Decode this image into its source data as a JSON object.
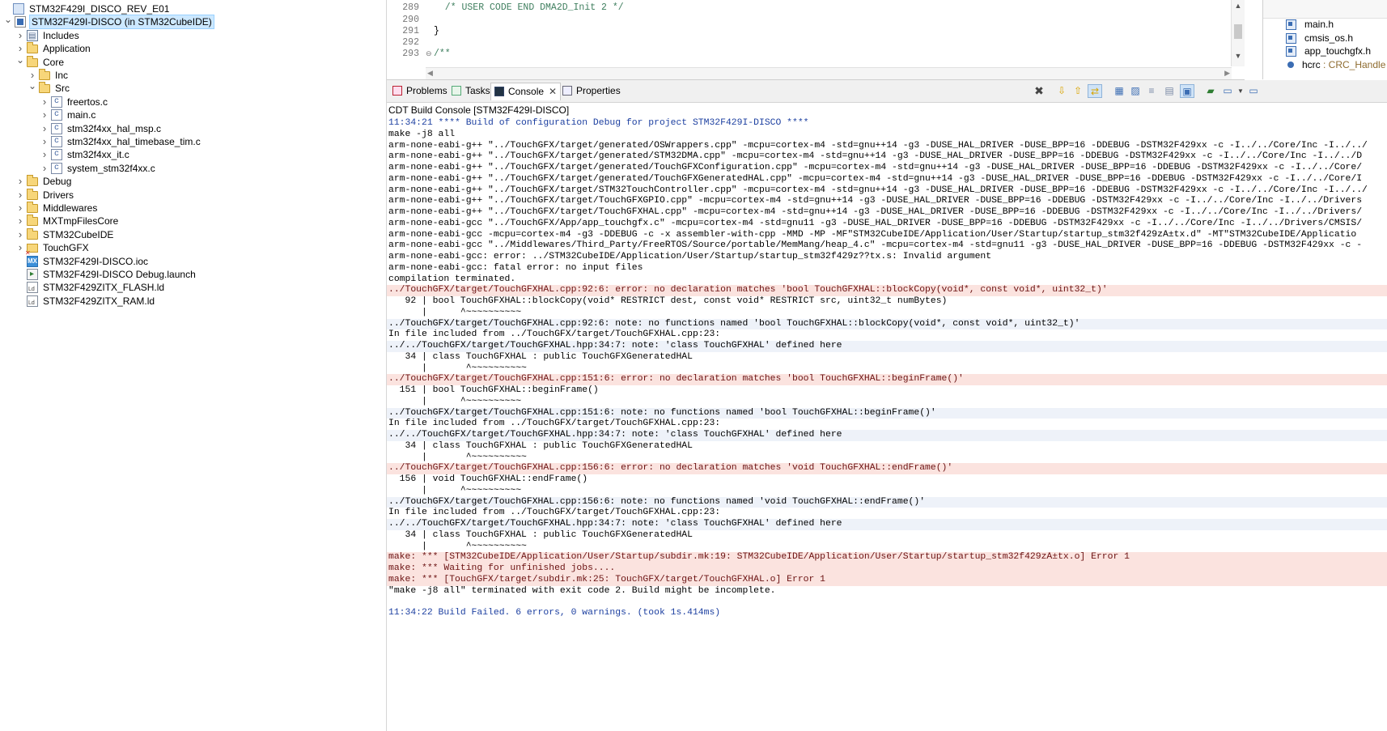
{
  "explorer": {
    "items": [
      {
        "label": "STM32F429I_DISCO_REV_E01",
        "icon": "project-icon",
        "twisty": ""
      },
      {
        "label": "STM32F429I-DISCO (in STM32CubeIDE)",
        "icon": "ide-project-icon",
        "twisty": "expanded"
      },
      {
        "label": "Includes",
        "icon": "includes-icon",
        "twisty": "collapsed"
      },
      {
        "label": "Application",
        "icon": "folder-icon",
        "twisty": "collapsed"
      },
      {
        "label": "Core",
        "icon": "folder-icon",
        "twisty": "expanded"
      },
      {
        "label": "Inc",
        "icon": "folder-icon",
        "twisty": "collapsed"
      },
      {
        "label": "Src",
        "icon": "folder-icon",
        "twisty": "expanded"
      },
      {
        "label": "freertos.c",
        "icon": "c-file-icon",
        "twisty": "collapsed"
      },
      {
        "label": "main.c",
        "icon": "c-file-icon",
        "twisty": "collapsed"
      },
      {
        "label": "stm32f4xx_hal_msp.c",
        "icon": "c-file-icon",
        "twisty": "collapsed"
      },
      {
        "label": "stm32f4xx_hal_timebase_tim.c",
        "icon": "c-file-icon",
        "twisty": "collapsed"
      },
      {
        "label": "stm32f4xx_it.c",
        "icon": "c-file-icon",
        "twisty": "collapsed"
      },
      {
        "label": "system_stm32f4xx.c",
        "icon": "c-file-icon",
        "twisty": "collapsed"
      },
      {
        "label": "Debug",
        "icon": "folder-icon",
        "twisty": "collapsed"
      },
      {
        "label": "Drivers",
        "icon": "folder-icon",
        "twisty": "collapsed"
      },
      {
        "label": "Middlewares",
        "icon": "folder-icon",
        "twisty": "collapsed"
      },
      {
        "label": "MXTmpFilesCore",
        "icon": "folder-icon",
        "twisty": "collapsed"
      },
      {
        "label": "STM32CubeIDE",
        "icon": "folder-icon",
        "twisty": "collapsed"
      },
      {
        "label": "TouchGFX",
        "icon": "folder-error-icon",
        "twisty": "collapsed"
      },
      {
        "label": "STM32F429I-DISCO.ioc",
        "icon": "mx-file-icon",
        "twisty": ""
      },
      {
        "label": "STM32F429I-DISCO Debug.launch",
        "icon": "launch-file-icon",
        "twisty": ""
      },
      {
        "label": "STM32F429ZITX_FLASH.ld",
        "icon": "ld-file-icon",
        "twisty": ""
      },
      {
        "label": "STM32F429ZITX_RAM.ld",
        "icon": "ld-file-icon",
        "twisty": ""
      }
    ]
  },
  "editor": {
    "lines": [
      {
        "num": "289",
        "code": "  /* USER CODE END DMA2D_Init 2 */",
        "kind": "comment"
      },
      {
        "num": "290",
        "code": "",
        "kind": "code"
      },
      {
        "num": "291",
        "code": "}",
        "kind": "code"
      },
      {
        "num": "292",
        "code": "",
        "kind": "code"
      },
      {
        "num": "293",
        "code": "/**",
        "kind": "comment"
      }
    ]
  },
  "outline": {
    "items": [
      {
        "label": "main.h",
        "type": "",
        "icon": "header-file-icon"
      },
      {
        "label": "cmsis_os.h",
        "type": "",
        "icon": "header-file-icon"
      },
      {
        "label": "app_touchgfx.h",
        "type": "",
        "icon": "header-file-icon"
      },
      {
        "label": "hcrc",
        "type": " : CRC_Handle",
        "icon": "variable-icon"
      }
    ]
  },
  "console": {
    "tabs": [
      {
        "label": "Problems",
        "icon": "problems-icon"
      },
      {
        "label": "Tasks",
        "icon": "tasks-icon"
      },
      {
        "label": "Console",
        "icon": "console-icon"
      },
      {
        "label": "Properties",
        "icon": "properties-icon"
      }
    ],
    "close_glyph": "✕",
    "title": "CDT Build Console [STM32F429I-DISCO]",
    "lines": [
      {
        "text": "11:34:21 **** Build of configuration Debug for project STM32F429I-DISCO ****",
        "kind": "info"
      },
      {
        "text": "make -j8 all",
        "kind": "normal"
      },
      {
        "text": "arm-none-eabi-g++ \"../TouchGFX/target/generated/OSWrappers.cpp\" -mcpu=cortex-m4 -std=gnu++14 -g3 -DUSE_HAL_DRIVER -DUSE_BPP=16 -DDEBUG -DSTM32F429xx -c -I../../Core/Inc -I../../",
        "kind": "normal"
      },
      {
        "text": "arm-none-eabi-g++ \"../TouchGFX/target/generated/STM32DMA.cpp\" -mcpu=cortex-m4 -std=gnu++14 -g3 -DUSE_HAL_DRIVER -DUSE_BPP=16 -DDEBUG -DSTM32F429xx -c -I../../Core/Inc -I../../D",
        "kind": "normal"
      },
      {
        "text": "arm-none-eabi-g++ \"../TouchGFX/target/generated/TouchGFXConfiguration.cpp\" -mcpu=cortex-m4 -std=gnu++14 -g3 -DUSE_HAL_DRIVER -DUSE_BPP=16 -DDEBUG -DSTM32F429xx -c -I../../Core/",
        "kind": "normal"
      },
      {
        "text": "arm-none-eabi-g++ \"../TouchGFX/target/generated/TouchGFXGeneratedHAL.cpp\" -mcpu=cortex-m4 -std=gnu++14 -g3 -DUSE_HAL_DRIVER -DUSE_BPP=16 -DDEBUG -DSTM32F429xx -c -I../../Core/I",
        "kind": "normal"
      },
      {
        "text": "arm-none-eabi-g++ \"../TouchGFX/target/STM32TouchController.cpp\" -mcpu=cortex-m4 -std=gnu++14 -g3 -DUSE_HAL_DRIVER -DUSE_BPP=16 -DDEBUG -DSTM32F429xx -c -I../../Core/Inc -I../../",
        "kind": "normal"
      },
      {
        "text": "arm-none-eabi-g++ \"../TouchGFX/target/TouchGFXGPIO.cpp\" -mcpu=cortex-m4 -std=gnu++14 -g3 -DUSE_HAL_DRIVER -DUSE_BPP=16 -DDEBUG -DSTM32F429xx -c -I../../Core/Inc -I../../Drivers",
        "kind": "normal"
      },
      {
        "text": "arm-none-eabi-g++ \"../TouchGFX/target/TouchGFXHAL.cpp\" -mcpu=cortex-m4 -std=gnu++14 -g3 -DUSE_HAL_DRIVER -DUSE_BPP=16 -DDEBUG -DSTM32F429xx -c -I../../Core/Inc -I../../Drivers/",
        "kind": "normal"
      },
      {
        "text": "arm-none-eabi-gcc \"../TouchGFX/App/app_touchgfx.c\" -mcpu=cortex-m4 -std=gnu11 -g3 -DUSE_HAL_DRIVER -DUSE_BPP=16 -DDEBUG -DSTM32F429xx -c -I../../Core/Inc -I../../Drivers/CMSIS/",
        "kind": "normal"
      },
      {
        "text": "arm-none-eabi-gcc -mcpu=cortex-m4 -g3 -DDEBUG -c -x assembler-with-cpp -MMD -MP -MF\"STM32CubeIDE/Application/User/Startup/startup_stm32f429zÃ±tx.d\" -MT\"STM32CubeIDE/Applicatio",
        "kind": "normal"
      },
      {
        "text": "arm-none-eabi-gcc \"../Middlewares/Third_Party/FreeRTOS/Source/portable/MemMang/heap_4.c\" -mcpu=cortex-m4 -std=gnu11 -g3 -DUSE_HAL_DRIVER -DUSE_BPP=16 -DDEBUG -DSTM32F429xx -c -",
        "kind": "normal"
      },
      {
        "text": "arm-none-eabi-gcc: error: ../STM32CubeIDE/Application/User/Startup/startup_stm32f429z??tx.s: Invalid argument",
        "kind": "normal"
      },
      {
        "text": "arm-none-eabi-gcc: fatal error: no input files",
        "kind": "normal"
      },
      {
        "text": "compilation terminated.",
        "kind": "normal"
      },
      {
        "text": "../TouchGFX/target/TouchGFXHAL.cpp:92:6: error: no declaration matches 'bool TouchGFXHAL::blockCopy(void*, const void*, uint32_t)'",
        "kind": "error"
      },
      {
        "text": "   92 | bool TouchGFXHAL::blockCopy(void* RESTRICT dest, const void* RESTRICT src, uint32_t numBytes)",
        "kind": "normal"
      },
      {
        "text": "      |      ^~~~~~~~~~~",
        "kind": "normal"
      },
      {
        "text": "../TouchGFX/target/TouchGFXHAL.cpp:92:6: note: no functions named 'bool TouchGFXHAL::blockCopy(void*, const void*, uint32_t)'",
        "kind": "warn"
      },
      {
        "text": "In file included from ../TouchGFX/target/TouchGFXHAL.cpp:23:",
        "kind": "normal"
      },
      {
        "text": "../../TouchGFX/target/TouchGFXHAL.hpp:34:7: note: 'class TouchGFXHAL' defined here",
        "kind": "warn"
      },
      {
        "text": "   34 | class TouchGFXHAL : public TouchGFXGeneratedHAL",
        "kind": "normal"
      },
      {
        "text": "      |       ^~~~~~~~~~~",
        "kind": "normal"
      },
      {
        "text": "../TouchGFX/target/TouchGFXHAL.cpp:151:6: error: no declaration matches 'bool TouchGFXHAL::beginFrame()'",
        "kind": "error"
      },
      {
        "text": "  151 | bool TouchGFXHAL::beginFrame()",
        "kind": "normal"
      },
      {
        "text": "      |      ^~~~~~~~~~~",
        "kind": "normal"
      },
      {
        "text": "../TouchGFX/target/TouchGFXHAL.cpp:151:6: note: no functions named 'bool TouchGFXHAL::beginFrame()'",
        "kind": "warn"
      },
      {
        "text": "In file included from ../TouchGFX/target/TouchGFXHAL.cpp:23:",
        "kind": "normal"
      },
      {
        "text": "../../TouchGFX/target/TouchGFXHAL.hpp:34:7: note: 'class TouchGFXHAL' defined here",
        "kind": "warn"
      },
      {
        "text": "   34 | class TouchGFXHAL : public TouchGFXGeneratedHAL",
        "kind": "normal"
      },
      {
        "text": "      |       ^~~~~~~~~~~",
        "kind": "normal"
      },
      {
        "text": "../TouchGFX/target/TouchGFXHAL.cpp:156:6: error: no declaration matches 'void TouchGFXHAL::endFrame()'",
        "kind": "error"
      },
      {
        "text": "  156 | void TouchGFXHAL::endFrame()",
        "kind": "normal"
      },
      {
        "text": "      |      ^~~~~~~~~~~",
        "kind": "normal"
      },
      {
        "text": "../TouchGFX/target/TouchGFXHAL.cpp:156:6: note: no functions named 'void TouchGFXHAL::endFrame()'",
        "kind": "warn"
      },
      {
        "text": "In file included from ../TouchGFX/target/TouchGFXHAL.cpp:23:",
        "kind": "normal"
      },
      {
        "text": "../../TouchGFX/target/TouchGFXHAL.hpp:34:7: note: 'class TouchGFXHAL' defined here",
        "kind": "warn"
      },
      {
        "text": "   34 | class TouchGFXHAL : public TouchGFXGeneratedHAL",
        "kind": "normal"
      },
      {
        "text": "      |       ^~~~~~~~~~~",
        "kind": "normal"
      },
      {
        "text": "make: *** [STM32CubeIDE/Application/User/Startup/subdir.mk:19: STM32CubeIDE/Application/User/Startup/startup_stm32f429zÃ±tx.o] Error 1",
        "kind": "error"
      },
      {
        "text": "make: *** Waiting for unfinished jobs....",
        "kind": "error"
      },
      {
        "text": "make: *** [TouchGFX/target/subdir.mk:25: TouchGFX/target/TouchGFXHAL.o] Error 1",
        "kind": "error"
      },
      {
        "text": "\"make -j8 all\" terminated with exit code 2. Build might be incomplete.",
        "kind": "normal"
      },
      {
        "text": "",
        "kind": "blank"
      },
      {
        "text": "11:34:22 Build Failed. 6 errors, 0 warnings. (took 1s.414ms)",
        "kind": "info"
      }
    ]
  }
}
